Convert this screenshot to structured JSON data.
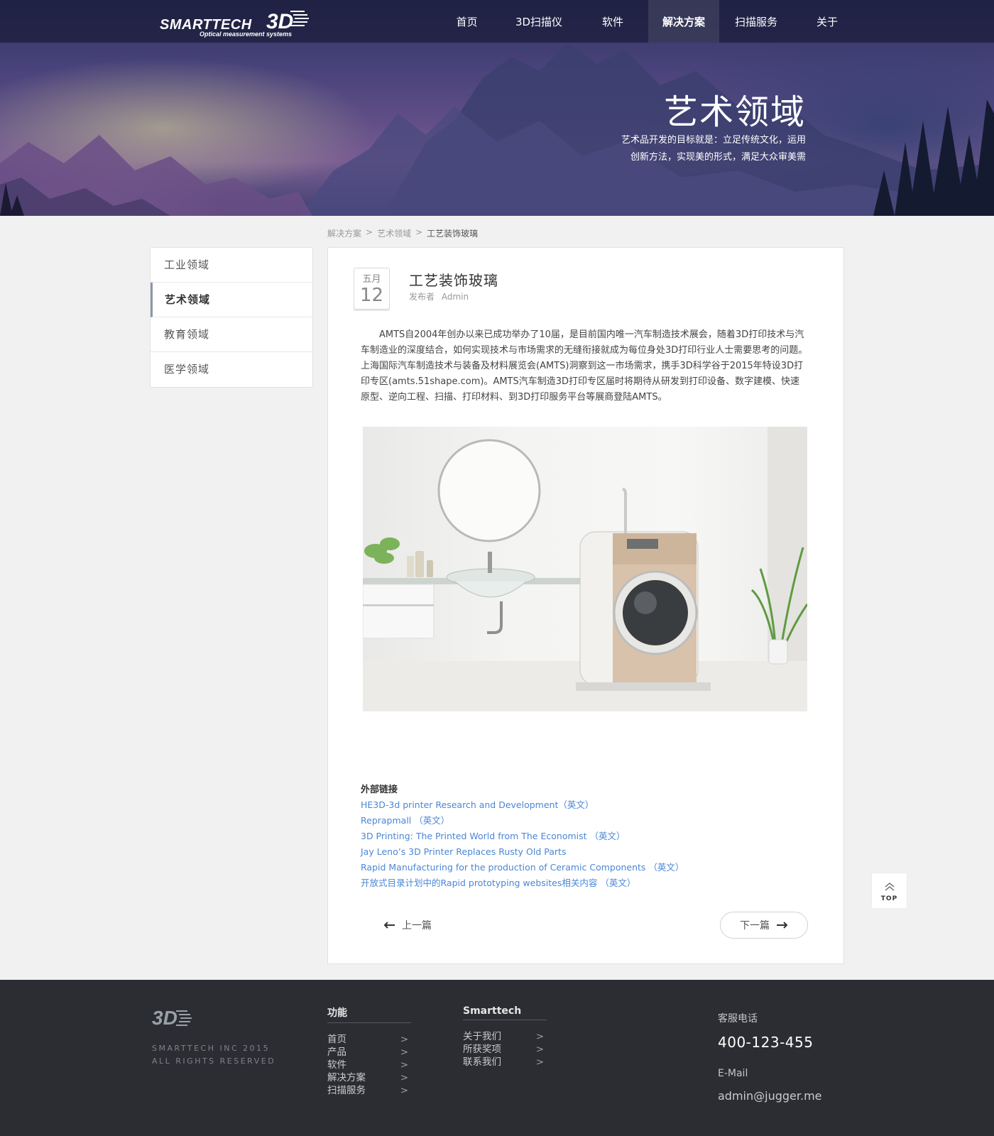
{
  "header": {
    "logo_text": "SMARTTECH",
    "logo_3d": "3D",
    "logo_tagline": "Optical measurement systems",
    "nav": [
      {
        "label": "首页",
        "active": false
      },
      {
        "label": "3D扫描仪",
        "active": false
      },
      {
        "label": "软件",
        "active": false
      },
      {
        "label": "解决方案",
        "active": true
      },
      {
        "label": "扫描服务",
        "active": false
      },
      {
        "label": "关于",
        "active": false
      }
    ]
  },
  "hero": {
    "title": "艺术领域",
    "desc_line1": "艺术品开发的目标就是：立足传统文化，运用",
    "desc_line2": "创新方法，实现美的形式，满足大众审美需"
  },
  "breadcrumb": {
    "items": [
      "解决方案",
      "艺术领域"
    ],
    "separator": ">",
    "current": "工艺装饰玻璃"
  },
  "sidebar": {
    "items": [
      {
        "label": "工业领域",
        "active": false
      },
      {
        "label": "艺术领域",
        "active": true
      },
      {
        "label": "教育领域",
        "active": false
      },
      {
        "label": "医学领域",
        "active": false
      }
    ]
  },
  "article": {
    "month": "五月",
    "day": "12",
    "title": "工艺装饰玻璃",
    "author_label": "发布者",
    "author": "Admin",
    "body": "AMTS自2004年创办以来已成功举办了10届，是目前国内唯一汽车制造技术展会，随着3D打印技术与汽车制造业的深度结合，如何实现技术与市场需求的无缝衔接就成为每位身处3D打印行业人士需要思考的问题。上海国际汽车制造技术与装备及材料展览会(AMTS)洞察到这一市场需求，携手3D科学谷于2015年特设3D打印专区(amts.51shape.com)。AMTS汽车制造3D打印专区届时将期待从研发到打印设备、数字建模、快速原型、逆向工程、扫描、打印材料、到3D打印服务平台等展商登陆AMTS。",
    "links_title": "外部链接",
    "links": [
      "HE3D-3d printer Research and Development（英文）",
      "Reprapmall （英文）",
      "3D Printing: The Printed World from The Economist （英文）",
      "Jay Leno’s 3D Printer Replaces Rusty Old Parts",
      "Rapid Manufacturing for the production of Ceramic Components （英文）",
      "开放式目录计划中的Rapid prototyping websites相关内容 （英文）"
    ],
    "prev_label": "上一篇",
    "next_label": "下一篇"
  },
  "top_button": {
    "label": "TOP"
  },
  "footer": {
    "logo_text": "3D",
    "copyright_line1": "SMARTTECH INC  2015",
    "copyright_line2": "ALL RIGHTS RESERVED",
    "col1": {
      "title": "功能",
      "items": [
        "首页",
        "产品",
        "软件",
        "解决方案",
        "扫描服务"
      ]
    },
    "col2": {
      "title": "Smarttech",
      "items": [
        "关于我们",
        "所获奖项",
        "联系我们"
      ]
    },
    "arrow": ">",
    "phone_label": "客服电话",
    "phone": "400-123-455",
    "email_label": "E-Mail",
    "email": "admin@jugger.me"
  },
  "colors": {
    "accent_link": "#4a86d6",
    "footer_bg": "#2b2d32",
    "page_bg": "#f1f1f1",
    "sidebar_active_bar": "#8a97a8"
  }
}
